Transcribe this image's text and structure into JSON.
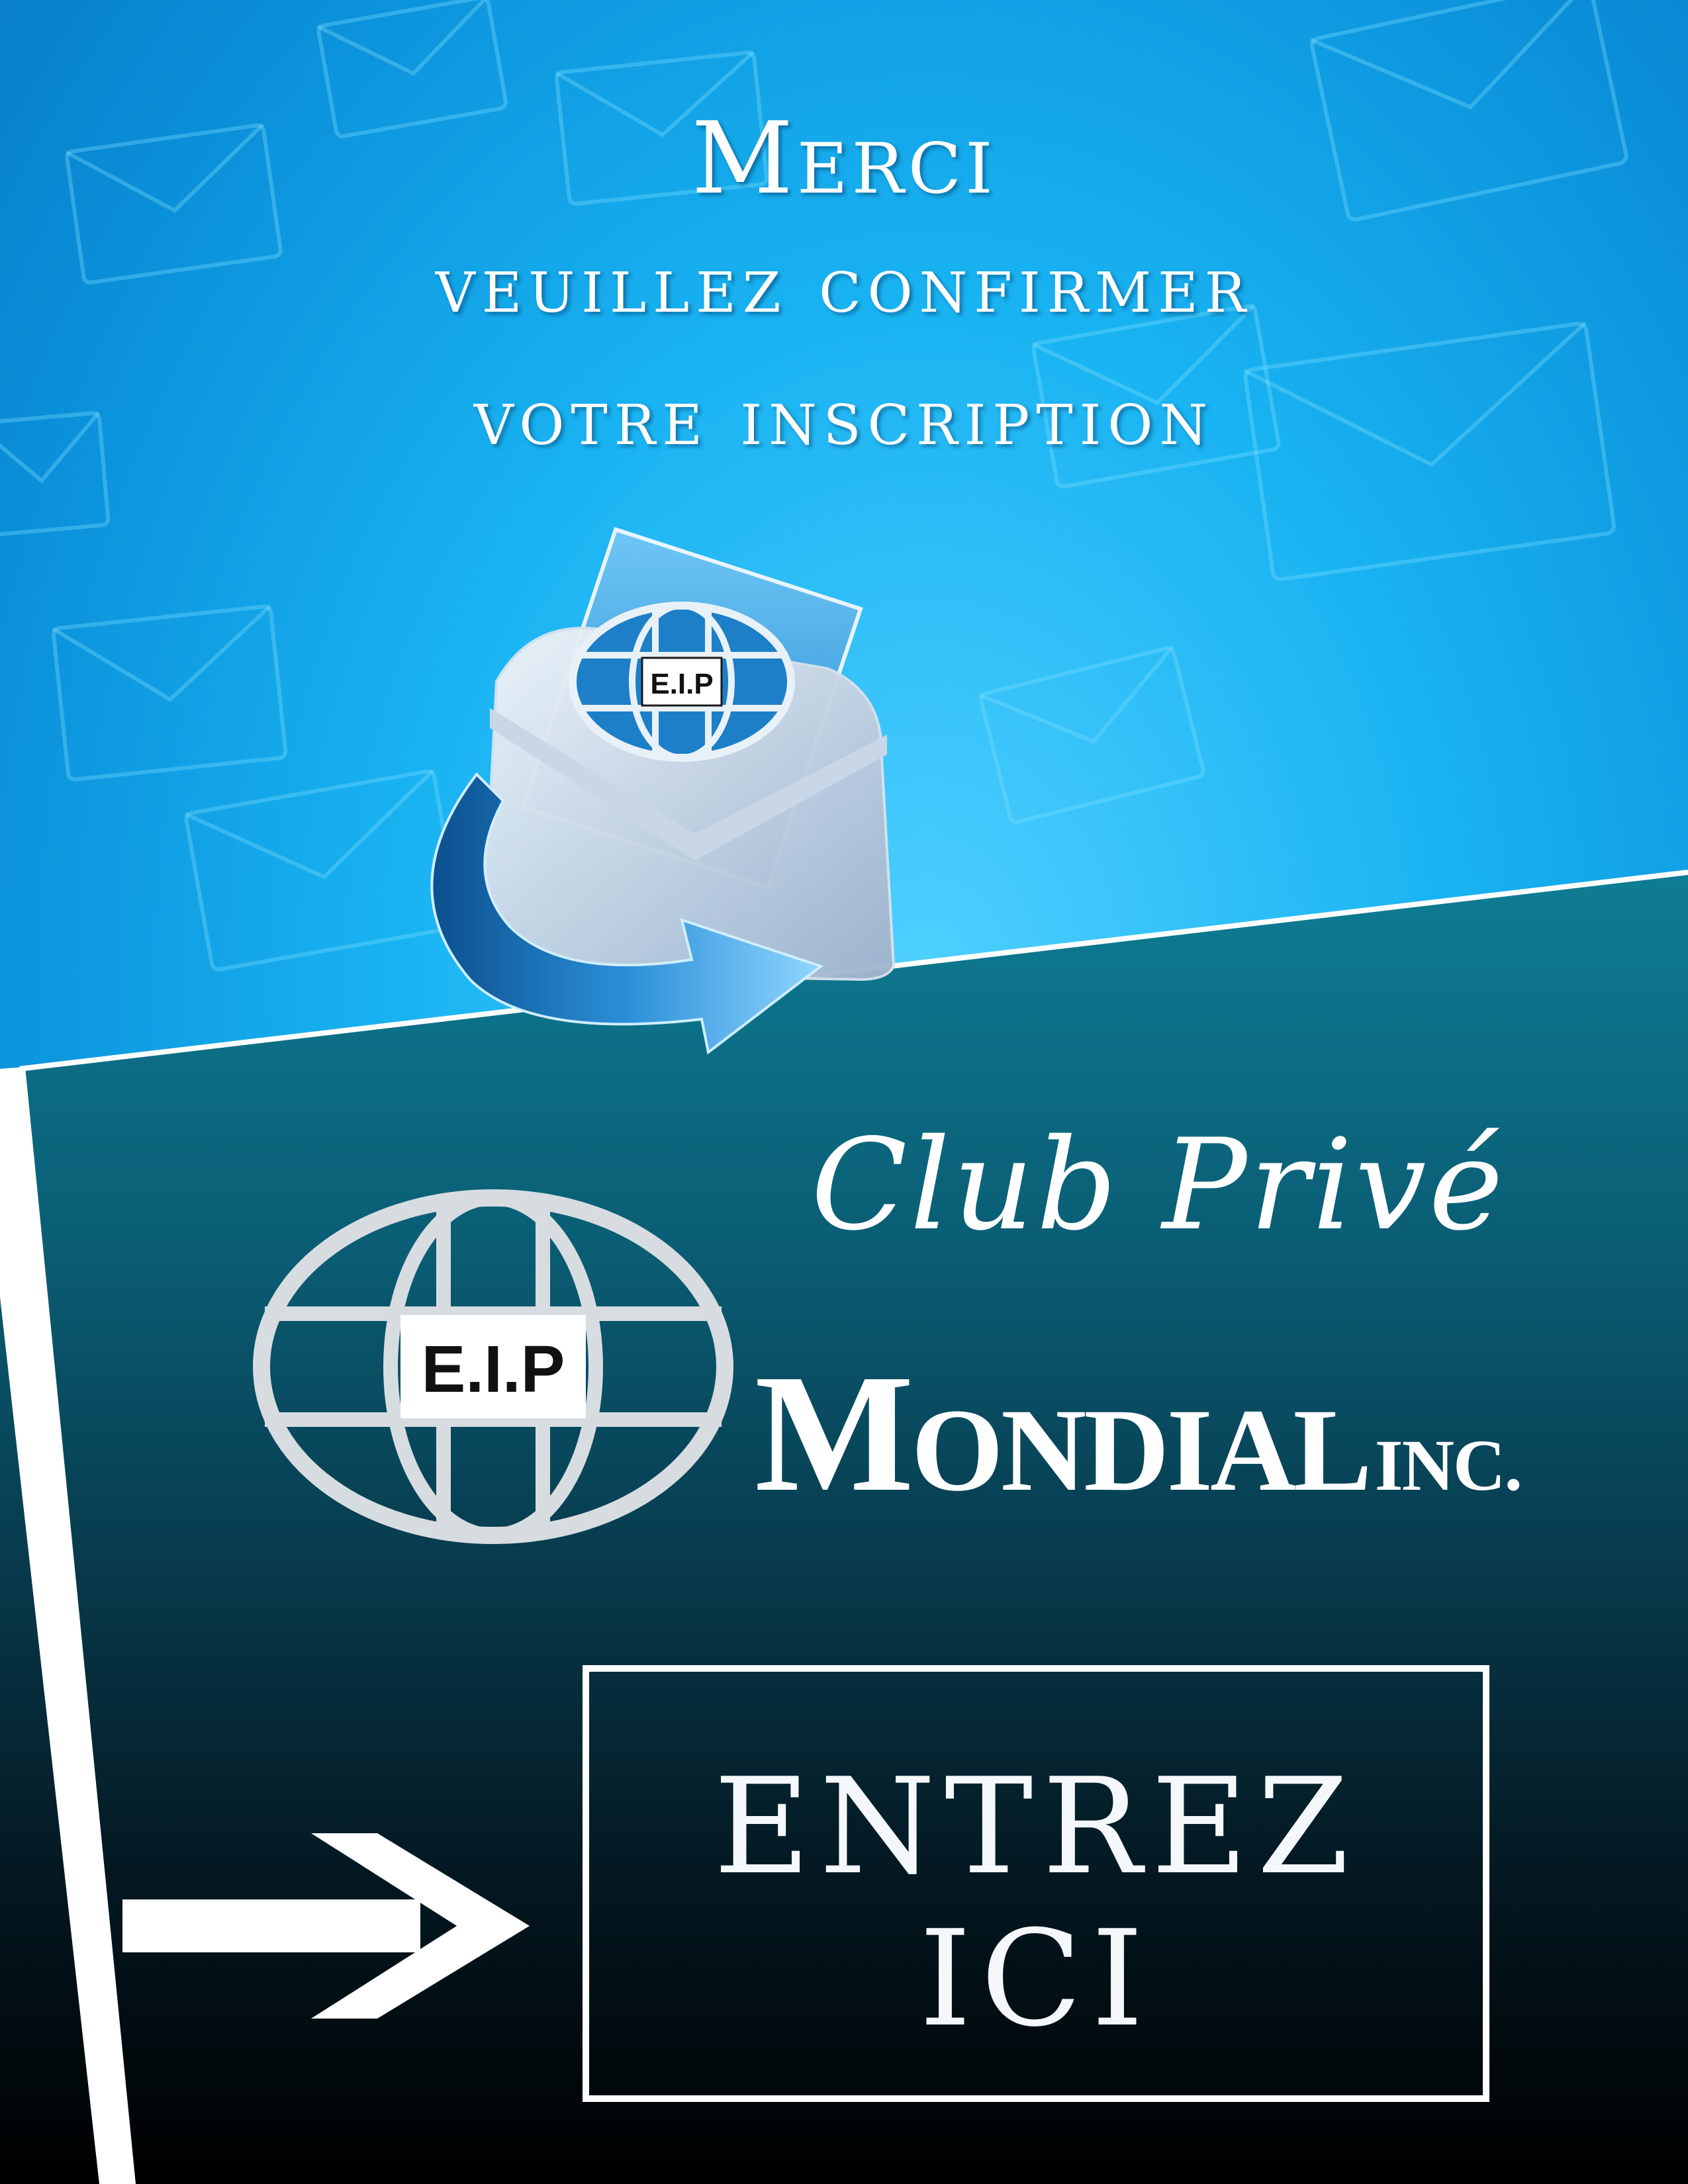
{
  "header": {
    "title": "Merci",
    "line1": "veuillez confirmer",
    "line2": "votre inscription"
  },
  "envelope_logo": {
    "badge": "E.I.P",
    "icon": "email-envelope-icon"
  },
  "brand": {
    "script_line": "Club Privé",
    "name": "Mondial",
    "suffix": "inc.",
    "logo_badge": "E.I.P",
    "logo_icon": "globe-logo-icon"
  },
  "cta": {
    "line1": "ENTREZ",
    "line2": "ICI",
    "arrow_icon": "arrow-right-icon"
  },
  "colors": {
    "sky_blue": "#19b3f2",
    "teal": "#0e7e95",
    "dark": "#000000",
    "text": "#ffffff"
  }
}
